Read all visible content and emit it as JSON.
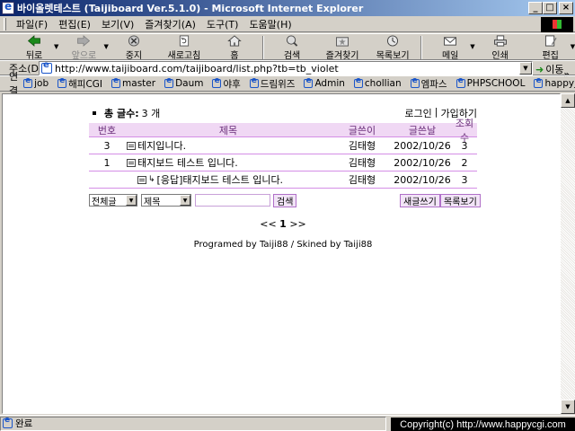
{
  "window": {
    "title": "바이올렛테스트 (Taijiboard Ver.5.1.0) - Microsoft Internet Explorer",
    "min_label": "_",
    "max_label": "□",
    "close_label": "×"
  },
  "menu": [
    "파일(F)",
    "편집(E)",
    "보기(V)",
    "즐겨찾기(A)",
    "도구(T)",
    "도움말(H)"
  ],
  "toolbar": {
    "back": "뒤로",
    "forward": "앞으로",
    "stop": "중지",
    "refresh": "새로고침",
    "home": "홈",
    "search": "검색",
    "favorites": "즐겨찾기",
    "history": "목록보기",
    "mail": "메일",
    "print": "인쇄",
    "edit": "편집",
    "more": "»"
  },
  "address": {
    "label": "주소(D)",
    "url": "http://www.taijiboard.com/taijiboard/list.php?tb=tb_violet",
    "go_label": "이동"
  },
  "links": {
    "label": "연결",
    "items": [
      "job",
      "해피CGI",
      "master",
      "Daum",
      "야후",
      "드림위즈",
      "Admin",
      "chollian",
      "엠파스",
      "PHPSCHOOL",
      "happyjob"
    ]
  },
  "board": {
    "total_label": "총 글수:",
    "total_value": "3 개",
    "login": "로그인",
    "divider": "|",
    "join": "가입하기",
    "headers": {
      "num": "번호",
      "title": "제목",
      "writer": "글쓴이",
      "date": "글쓴날",
      "views": "조회수"
    },
    "rows": [
      {
        "num": "3",
        "title": "테지입니다.",
        "writer": "김태형",
        "date": "2002/10/26",
        "views": "3",
        "reply": false
      },
      {
        "num": "1",
        "title": "태지보드 테스트 입니다.",
        "writer": "김태형",
        "date": "2002/10/26",
        "views": "2",
        "reply": false
      },
      {
        "num": "",
        "title": "[응답]태지보드 테스트 입니다.",
        "writer": "김태형",
        "date": "2002/10/26",
        "views": "3",
        "reply": true
      }
    ],
    "search_scope": "전체글",
    "search_field": "제목",
    "search_keyword": "",
    "search_button": "검색",
    "write_button": "새글쓰기",
    "list_button": "목록보기",
    "pager_prev": "<<",
    "pager_current": "1",
    "pager_next": ">>",
    "credit": "Programed by Taiji88 / Skined by Taiji88"
  },
  "status": {
    "text": "완료",
    "overlay": "Copyright(c) http://www.happycgi.com"
  }
}
